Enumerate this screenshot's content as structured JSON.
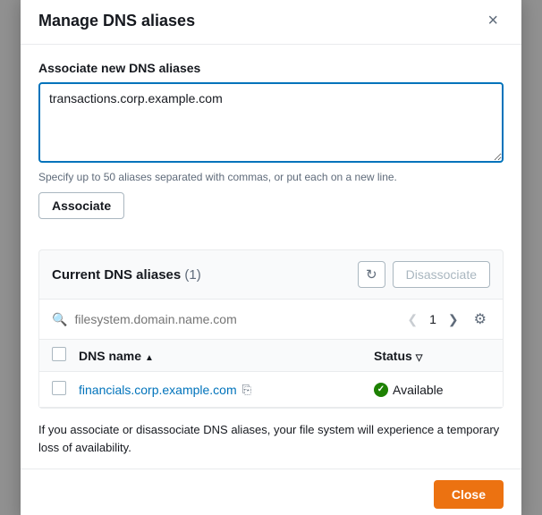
{
  "modal": {
    "title": "Manage DNS aliases",
    "close_label": "×"
  },
  "associate_section": {
    "label": "Associate new DNS aliases",
    "textarea_value": "transactions.corp.example.com",
    "hint": "Specify up to 50 aliases separated with commas, or put each on a new line.",
    "associate_button": "Associate"
  },
  "current_section": {
    "title": "Current DNS aliases",
    "count": "(1)",
    "disassociate_button": "Disassociate",
    "search_placeholder": "filesystem.domain.name.com",
    "page_current": "1",
    "columns": [
      {
        "label": "DNS name",
        "sort": "asc"
      },
      {
        "label": "Status",
        "sort": "desc"
      }
    ],
    "rows": [
      {
        "dns_name": "financials.corp.example.com",
        "status": "Available"
      }
    ]
  },
  "footer_note": "If you associate or disassociate DNS aliases, your file system will experience a temporary loss of availability.",
  "close_button": "Close"
}
